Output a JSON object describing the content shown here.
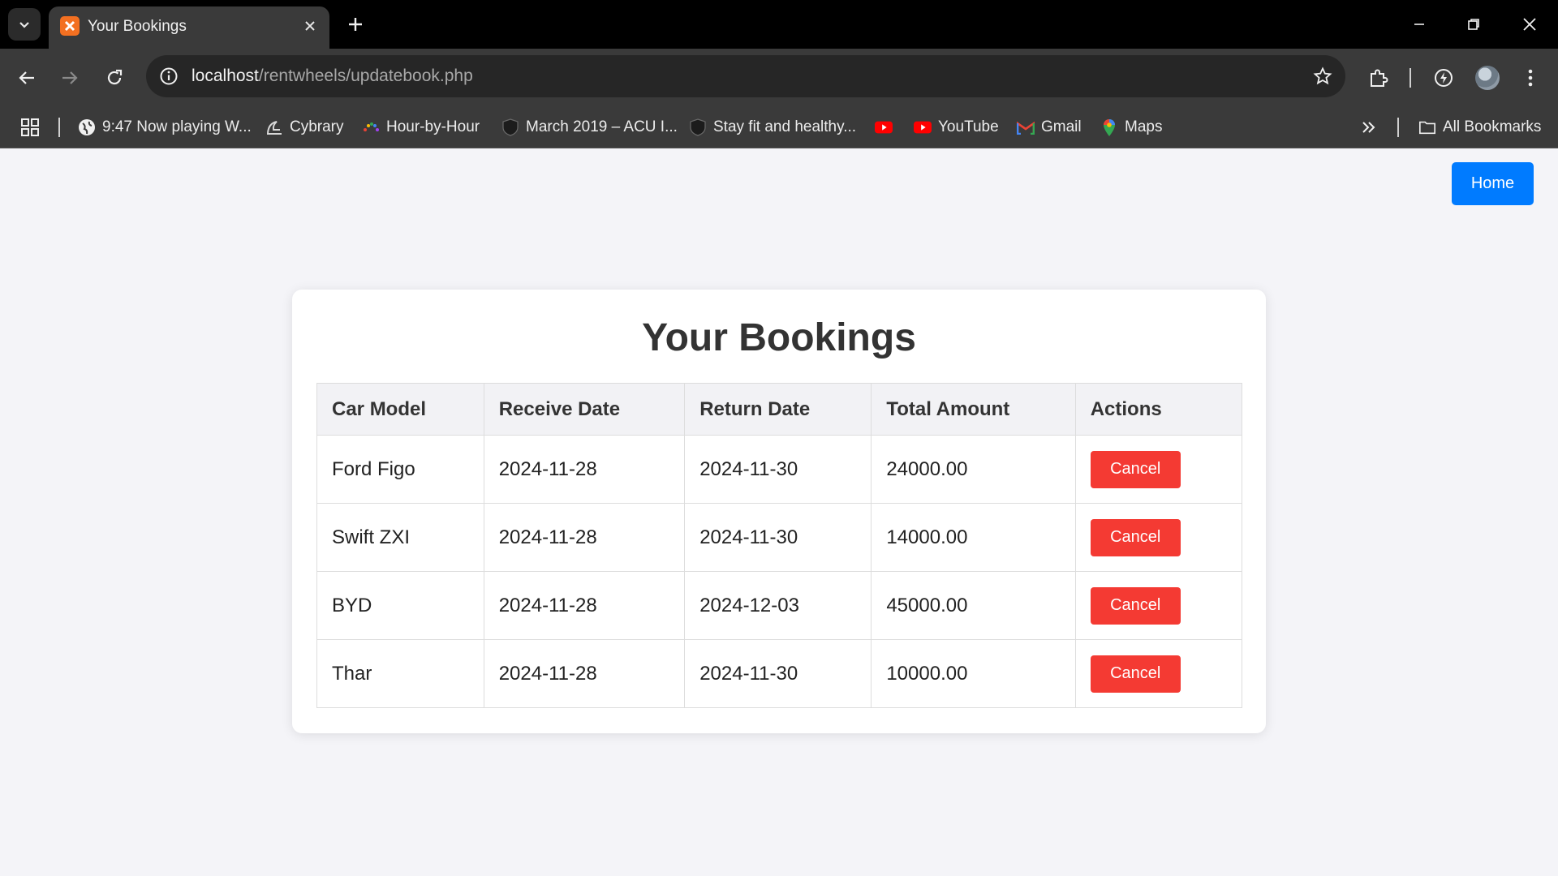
{
  "browser": {
    "tab": {
      "title": "Your Bookings"
    },
    "address": {
      "host": "localhost",
      "path": "/rentwheels/updatebook.php"
    },
    "bookmarks": [
      {
        "label": "9:47 Now playing W...",
        "icon": "globe-icon"
      },
      {
        "label": "Cybrary",
        "icon": "cybrary-icon"
      },
      {
        "label": "Hour-by-Hour",
        "icon": "weather-icon"
      },
      {
        "label": "March 2019 – ACU I...",
        "icon": "shield-icon"
      },
      {
        "label": "Stay fit and healthy...",
        "icon": "shield-icon"
      },
      {
        "label": "",
        "icon": "youtube-icon"
      },
      {
        "label": "YouTube",
        "icon": "youtube-icon"
      },
      {
        "label": "Gmail",
        "icon": "gmail-icon"
      },
      {
        "label": "Maps",
        "icon": "maps-icon"
      }
    ],
    "all_bookmarks_label": "All Bookmarks"
  },
  "page": {
    "home_label": "Home",
    "title": "Your Bookings",
    "columns": [
      "Car Model",
      "Receive Date",
      "Return Date",
      "Total Amount",
      "Actions"
    ],
    "rows": [
      {
        "car_model": "Ford Figo",
        "receive_date": "2024-11-28",
        "return_date": "2024-11-30",
        "total_amount": "24000.00",
        "action": "Cancel"
      },
      {
        "car_model": "Swift ZXI",
        "receive_date": "2024-11-28",
        "return_date": "2024-11-30",
        "total_amount": "14000.00",
        "action": "Cancel"
      },
      {
        "car_model": "BYD",
        "receive_date": "2024-11-28",
        "return_date": "2024-12-03",
        "total_amount": "45000.00",
        "action": "Cancel"
      },
      {
        "car_model": "Thar",
        "receive_date": "2024-11-28",
        "return_date": "2024-11-30",
        "total_amount": "10000.00",
        "action": "Cancel"
      }
    ]
  },
  "colors": {
    "primary_button": "#007bff",
    "danger_button": "#f43a33",
    "page_background": "#f4f4f8"
  }
}
